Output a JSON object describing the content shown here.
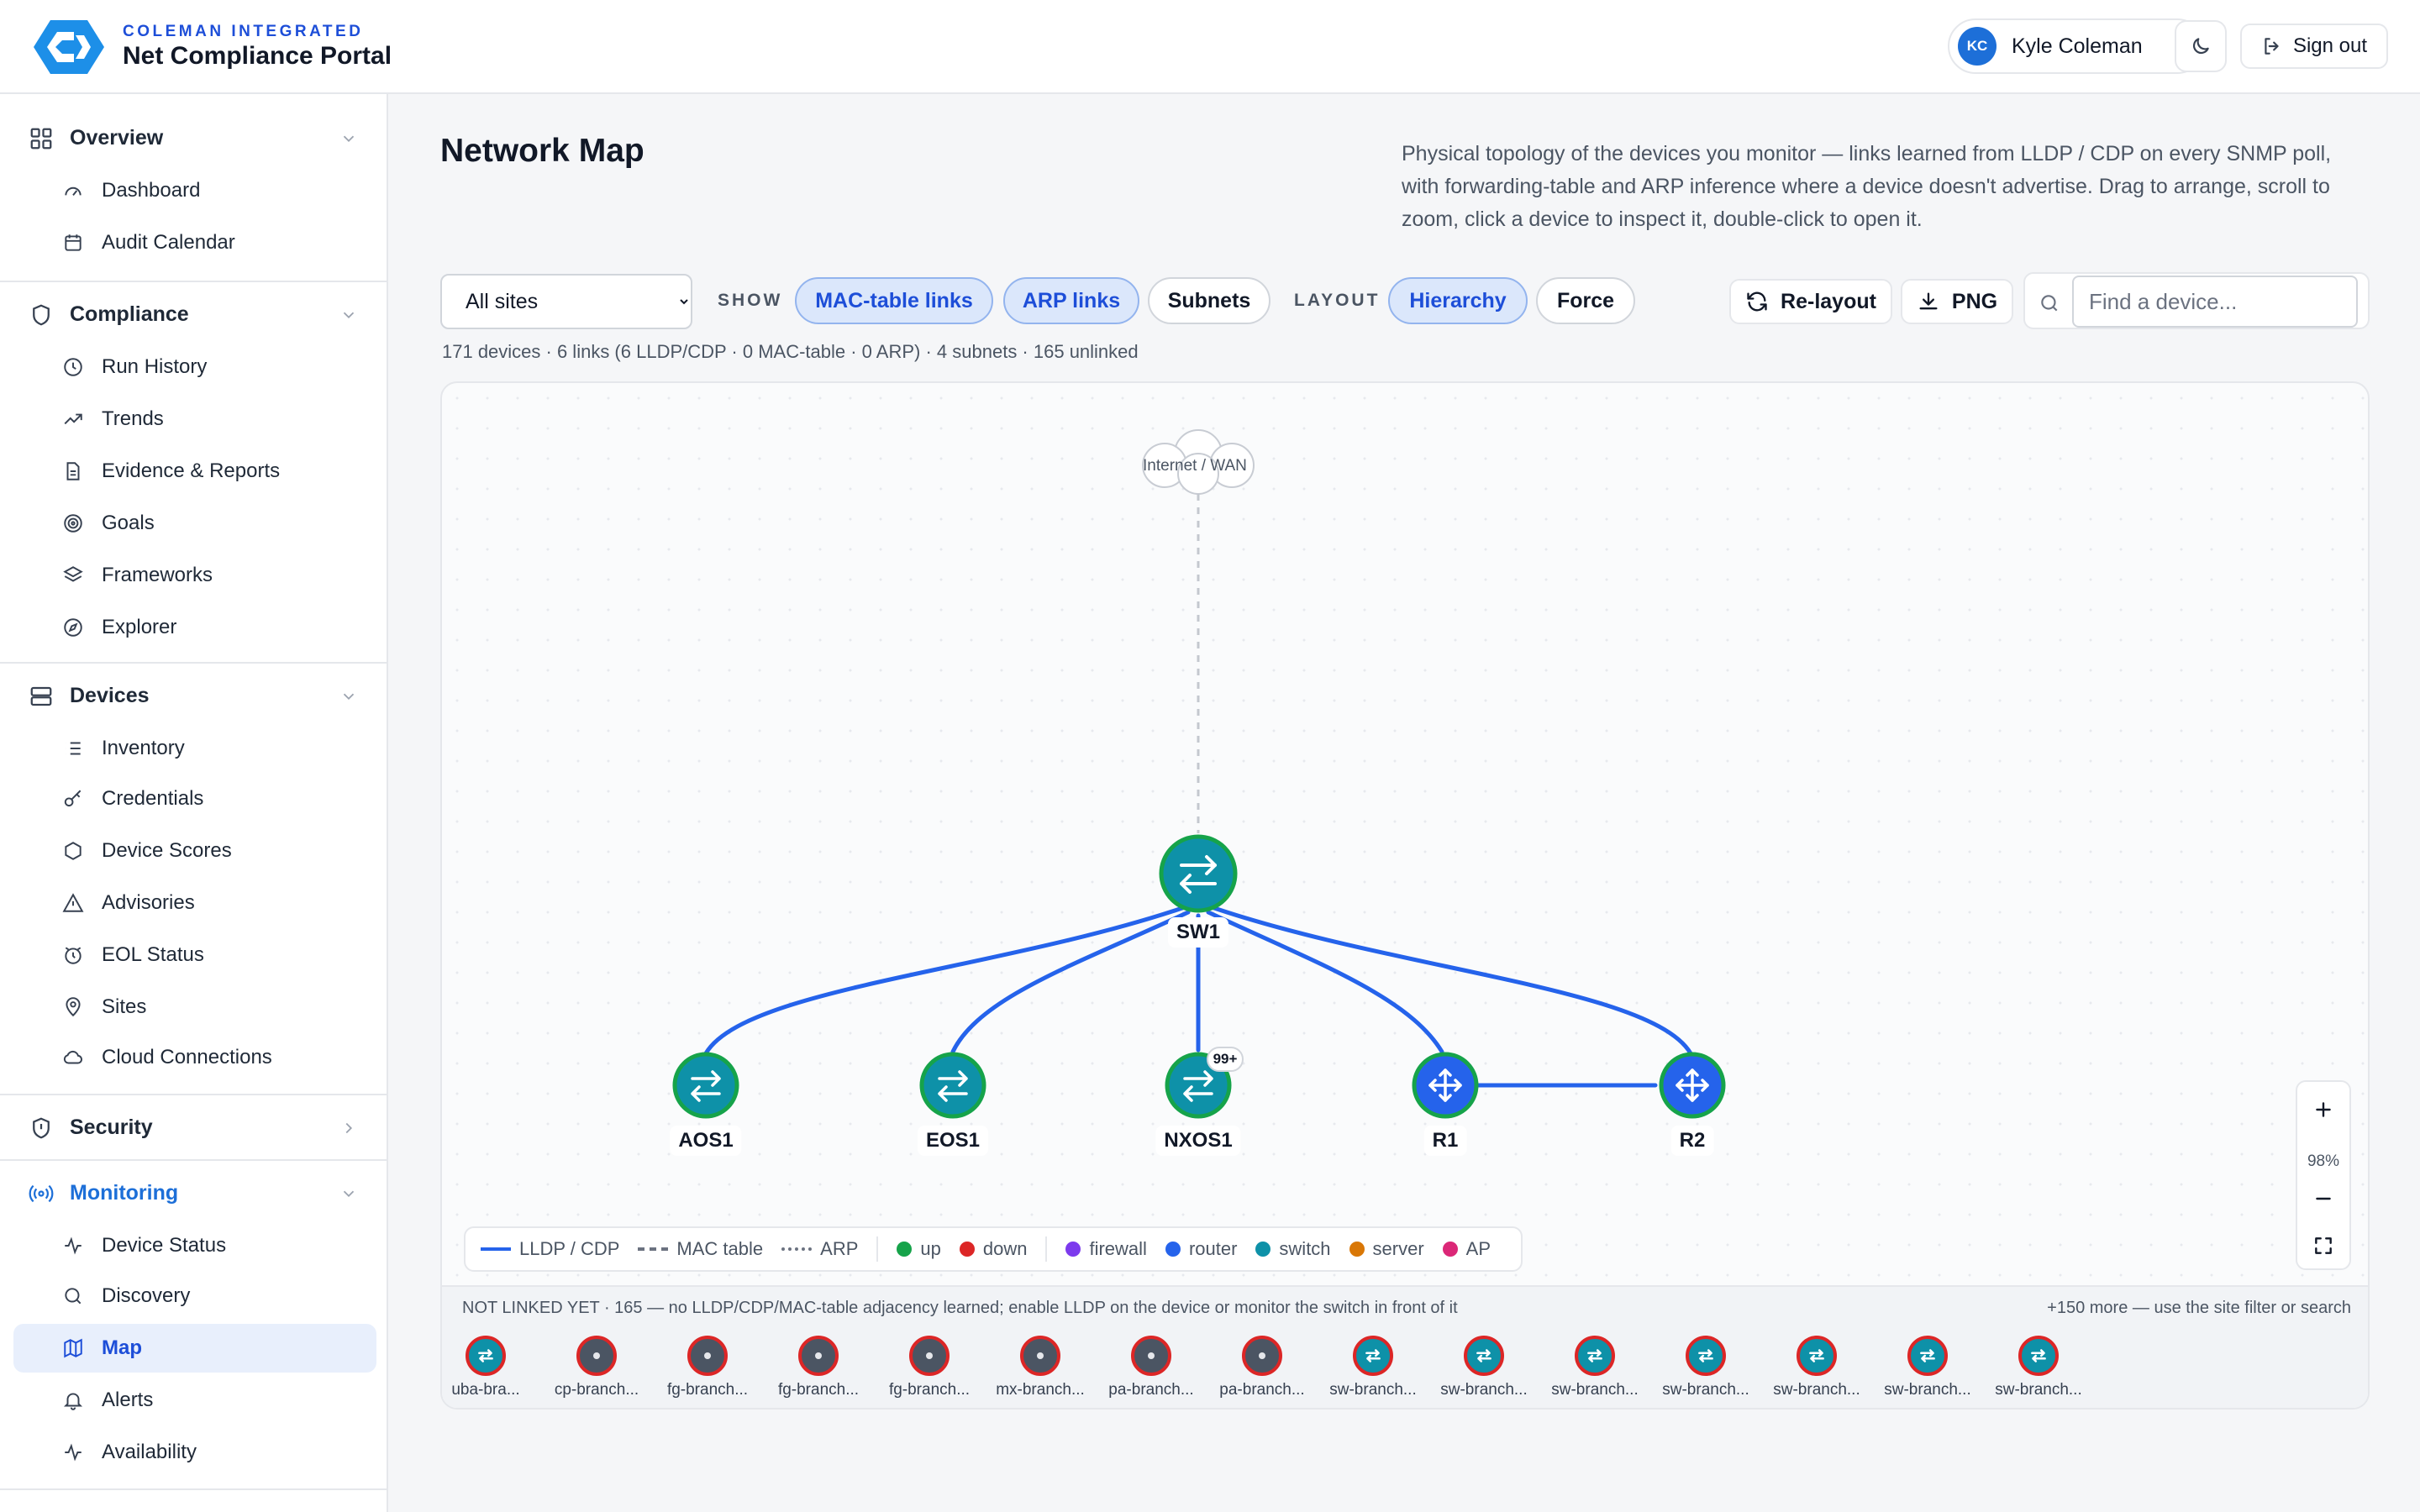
{
  "brand": {
    "org": "COLEMAN INTEGRATED",
    "app": "Net Compliance Portal"
  },
  "user": {
    "initials": "KC",
    "name": "Kyle Coleman",
    "signout": "Sign out"
  },
  "sidebar": {
    "overview": {
      "label": "Overview",
      "items": [
        "Dashboard",
        "Audit Calendar"
      ]
    },
    "compliance": {
      "label": "Compliance",
      "items": [
        "Run History",
        "Trends",
        "Evidence & Reports",
        "Goals",
        "Frameworks",
        "Explorer"
      ]
    },
    "devices": {
      "label": "Devices",
      "items": [
        "Inventory",
        "Credentials",
        "Device Scores",
        "Advisories",
        "EOL Status",
        "Sites",
        "Cloud Connections"
      ]
    },
    "security": {
      "label": "Security"
    },
    "monitoring": {
      "label": "Monitoring",
      "items": [
        "Device Status",
        "Discovery",
        "Map",
        "Alerts",
        "Availability"
      ]
    }
  },
  "page": {
    "title": "Network Map",
    "description": "Physical topology of the devices you monitor — links learned from LLDP / CDP on every SNMP poll, with forwarding-table and ARP inference where a device doesn't advertise. Drag to arrange, scroll to zoom, click a device to inspect it, double-click to open it."
  },
  "toolbar": {
    "site_options": [
      "All sites"
    ],
    "site_selected": "All sites",
    "show_label": "SHOW",
    "show_pills": [
      {
        "label": "MAC-table links",
        "on": true
      },
      {
        "label": "ARP links",
        "on": true
      },
      {
        "label": "Subnets",
        "on": false
      }
    ],
    "layout_label": "LAYOUT",
    "layout_pills": [
      {
        "label": "Hierarchy",
        "on": true
      },
      {
        "label": "Force",
        "on": false
      }
    ],
    "relayout": "Re-layout",
    "png": "PNG",
    "search_placeholder": "Find a device..."
  },
  "stats": "171 devices · 6 links (6 LLDP/CDP · 0 MAC-table · 0 ARP) · 4 subnets · 165 unlinked",
  "map": {
    "cloud": "Internet / WAN",
    "nodes": [
      {
        "name": "SW1",
        "kind": "switch"
      },
      {
        "name": "AOS1",
        "kind": "switch"
      },
      {
        "name": "EOS1",
        "kind": "switch"
      },
      {
        "name": "NXOS1",
        "kind": "switch",
        "badge": "99+"
      },
      {
        "name": "R1",
        "kind": "router"
      },
      {
        "name": "R2",
        "kind": "router"
      }
    ],
    "zoom": "98%"
  },
  "legend": {
    "lldp": "LLDP / CDP",
    "mac": "MAC table",
    "arp": "ARP",
    "up": "up",
    "down": "down",
    "firewall": "firewall",
    "router": "router",
    "switch": "switch",
    "server": "server",
    "ap": "AP",
    "colors": {
      "up": "#16a34a",
      "down": "#dc2626",
      "firewall": "#7c3aed",
      "router": "#2563eb",
      "switch": "#0e91a8",
      "server": "#d97706",
      "ap": "#db2777"
    }
  },
  "unlinked": {
    "note": "NOT LINKED YET · 165 — no LLDP/CDP/MAC-table adjacency learned; enable LLDP on the device or monitor the switch in front of it",
    "more": "+150 more — use the site filter or search",
    "devices": [
      {
        "name": "uba-bra...",
        "kind": "switch"
      },
      {
        "name": "cp-branch...",
        "kind": "firewall"
      },
      {
        "name": "fg-branch...",
        "kind": "firewall"
      },
      {
        "name": "fg-branch...",
        "kind": "firewall"
      },
      {
        "name": "fg-branch...",
        "kind": "firewall"
      },
      {
        "name": "mx-branch...",
        "kind": "firewall"
      },
      {
        "name": "pa-branch...",
        "kind": "firewall"
      },
      {
        "name": "pa-branch...",
        "kind": "firewall"
      },
      {
        "name": "sw-branch...",
        "kind": "switch"
      },
      {
        "name": "sw-branch...",
        "kind": "switch"
      },
      {
        "name": "sw-branch...",
        "kind": "switch"
      },
      {
        "name": "sw-branch...",
        "kind": "switch"
      },
      {
        "name": "sw-branch...",
        "kind": "switch"
      },
      {
        "name": "sw-branch...",
        "kind": "switch"
      },
      {
        "name": "sw-branch...",
        "kind": "switch"
      }
    ]
  }
}
